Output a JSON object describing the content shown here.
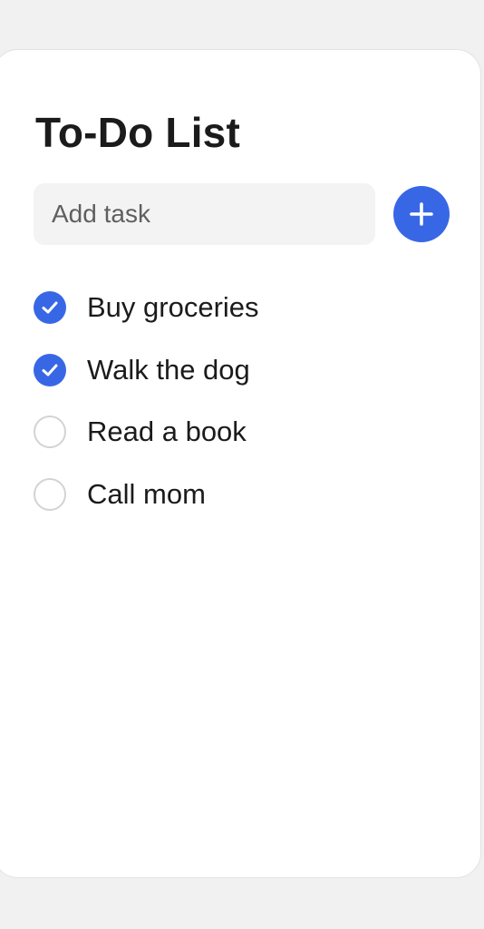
{
  "app": {
    "title": "To-Do List"
  },
  "add_task": {
    "placeholder": "Add task",
    "value": "",
    "button_icon": "plus-icon"
  },
  "tasks": [
    {
      "label": "Buy groceries",
      "completed": true
    },
    {
      "label": "Walk the dog",
      "completed": true
    },
    {
      "label": "Read a book",
      "completed": false
    },
    {
      "label": "Call mom",
      "completed": false
    }
  ],
  "colors": {
    "accent": "#3867e6",
    "text": "#1b1b1b",
    "input_bg": "#f3f3f3",
    "unchecked_border": "#d3d3d3",
    "page_bg": "#f1f1f1"
  }
}
